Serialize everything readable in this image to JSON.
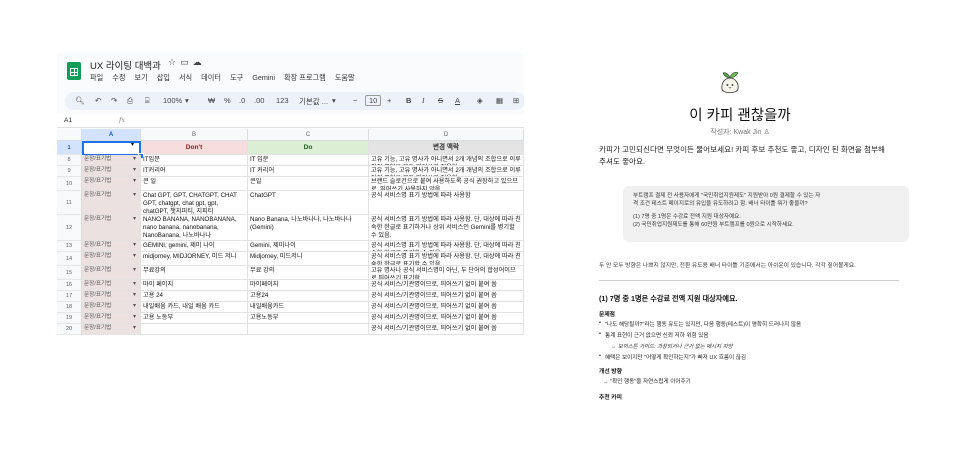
{
  "spreadsheet": {
    "title": "UX 라이팅 대백과",
    "title_icons": [
      "star-icon",
      "folder-icon",
      "cloud-icon"
    ],
    "menu": [
      "파일",
      "수정",
      "보기",
      "삽입",
      "서식",
      "데이터",
      "도구",
      "Gemini",
      "확장 프로그램",
      "도움말"
    ],
    "toolbar": {
      "zoom": "100%",
      "won": "₩",
      "percent": "%",
      "decimal_less": ".0",
      "decimal_more": ".00",
      "number_format": "123",
      "font": "기본값 ...",
      "font_size": "10",
      "minus": "−",
      "plus": "+",
      "bold": "B",
      "italic": "I",
      "strike": "S",
      "text_color": "A"
    },
    "name_box": "A1",
    "fx": "fx",
    "columns": [
      "A",
      "B",
      "C",
      "D"
    ],
    "header_row": {
      "num": "1",
      "b": "Don't",
      "c": "Do",
      "d": "변경 맥락"
    },
    "rows": [
      {
        "num": "8",
        "a": "문장/표기법",
        "b": "IT입문",
        "c": "IT 입문",
        "d": "고유 기능, 고유 명사가 아니면서 2개 개념의 조합으로 이루어진 표현은 모두 띄어쓰기 적용함"
      },
      {
        "num": "9",
        "a": "문장/표기법",
        "b": "IT커리어",
        "c": "IT 커리어",
        "d": "고유 기능, 고유 명사가 아니면서 2개 개념의 조합으로 이루어진 표현은 모두 띄어쓰기 적용함"
      },
      {
        "num": "10",
        "a": "문장/표기법",
        "b": "큰 일",
        "c": "큰일",
        "d": "브랜드 슬로건으로 붙여 사용하도록 공식 권장하고 있으므로, 띄어쓰기 사용하지 않음"
      },
      {
        "num": "11",
        "a": "문장/표기법",
        "b": "Chat GPT, GPT, CHATGPT, CHAT GPT, chatgpt, chat gpt, gpt, chatGPT, 챗지피티, 지피티",
        "c": "ChatGPT",
        "d": "공식 서비스명 표기 방법에 따라 사용함"
      },
      {
        "num": "12",
        "a": "문장/표기법",
        "b": "NANO BANANA, NANOBANANA, nano banana, nanobanana, NanoBanana, 나노바나나",
        "c": "Nano Banana, 나노바나나, 나노바나나(Gemini)",
        "d": "공식 서비스명 표기 방법에 따라 사용함. 단, 대상에 따라 친숙한 한글로 표기하거나 상위 서비스인 Gemini를 병기할 수 있음."
      },
      {
        "num": "13",
        "a": "문장/표기법",
        "b": "GEMINI, gemini, 제미 나이",
        "c": "Gemini, 제미나이",
        "d": "공식 서비스명 표기 방법에 따라 사용함. 단, 대상에 따라 친숙한 한글로 표기할 수 있음."
      },
      {
        "num": "14",
        "a": "문장/표기법",
        "b": "midjorney, MIDJORNEY, 미드 저니",
        "c": "Midjorney, 미드저니",
        "d": "공식 서비스명 표기 방법에 따라 사용함. 단, 대상에 따라 친숙한 한글로 표기할 수 있음."
      },
      {
        "num": "15",
        "a": "문장/표기법",
        "b": "무료강의",
        "c": "무료 강의",
        "d": "고유 명사나 공식 서비스명이 아닌, 두 단어의 합성어이므로 띄어쓰기 표기함"
      },
      {
        "num": "16",
        "a": "문장/표기법",
        "b": "마이 페이지",
        "c": "마이페이지",
        "d": "공식 서비스/기관명이므로, 띄어쓰기 없이 붙여 씀"
      },
      {
        "num": "17",
        "a": "문장/표기법",
        "b": "고용 24",
        "c": "고용24",
        "d": "공식 서비스/기관명이므로, 띄어쓰기 없이 붙여 씀"
      },
      {
        "num": "18",
        "a": "문장/표기법",
        "b": "내일배움 카드, 내일 배움 카드",
        "c": "내일배움카드",
        "d": "공식 서비스/기관명이므로, 띄어쓰기 없이 붙여 씀"
      },
      {
        "num": "19",
        "a": "문장/표기법",
        "b": "고용 노동부",
        "c": "고용노동부",
        "d": "공식 서비스/기관명이므로, 띄어쓰기 없이 붙여 씀"
      },
      {
        "num": "20",
        "a": "문장/표기법",
        "b": "",
        "c": "",
        "d": "공식 서비스/기관명이므로, 띄어쓰기 없이 붙여 씀"
      }
    ]
  },
  "document": {
    "title": "이 카피 괜찮을까",
    "author": "작성자: Kwak Jin",
    "intro": "카피가 고민되신다면 무엇이든 물어보세요! 카피 후보 추천도 좋고, 디자인 된 화면을 첨부해주셔도 좋아요.",
    "quote_lines": [
      "부트캠프 결제 전 사용자에게 \"국민취업지원제도\" 지원받아 0원 결제할 수 있는 자",
      "격 조건 테스트 페이지로의 유입을 유도하려고 함. 배너 타이틀 뭐가 좋을까?",
      "",
      "(1) 7명 중 1명은 수강료 전액 지원 대상자예요.",
      "(2) 국민취업지원제도를 통해 60만원 부트캠프를 0원으로 시작하세요."
    ],
    "note": "두 안 모두 방향은 나쁘지 않지만, 전환 유도용 배너 타이틀 기준에서는 아쉬운이 있습니다. 각각 짚어볼게요.",
    "section_title": "(1) 7명 중 1명은 수강료 전액 지원 대상자예요.",
    "problem_label": "문제점",
    "problems": [
      "\"나도 해당될까?\"라는 행동 유도는 있지만, 다음 행동(테스트)이 명확히 드러나지 않음",
      "통계 표현이 근거 없으면 신뢰 저하 위험 있음",
      "혜택은 보이지만 \"어떻게 확인하는지\"가 빠져 UX 흐름이 끊김"
    ],
    "problem_sub": "→ 보이스톤 가이드: 과장되거나 근거 없는 메시지 지양",
    "improve_label": "개선 방향",
    "improve_text": "→ \"확인 행동\"을 자연스럽게 이어주기",
    "recommend_label": "추천 카피"
  }
}
